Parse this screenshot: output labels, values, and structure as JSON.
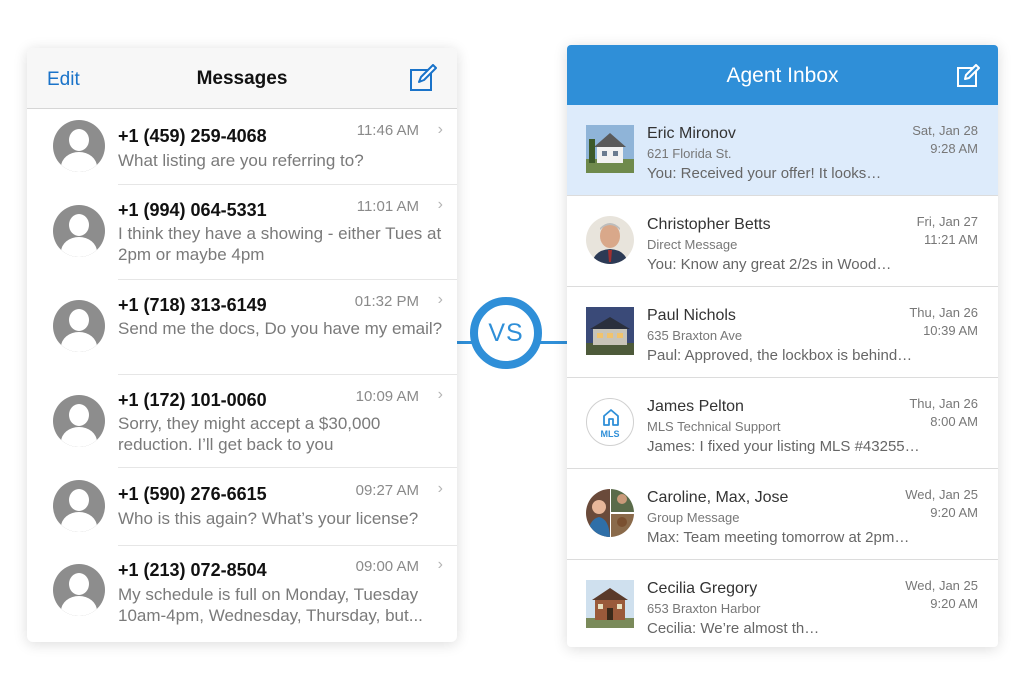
{
  "vs_label": "VS",
  "left": {
    "edit_label": "Edit",
    "title": "Messages",
    "compose_icon": "compose-icon",
    "messages": [
      {
        "phone": "+1 (459) 259-4068",
        "time": "11:46 AM",
        "preview": "What listing are you referring to?"
      },
      {
        "phone": "+1 (994) 064-5331",
        "time": "11:01 AM",
        "preview": "I think they have a showing - either Tues at 2pm or maybe 4pm"
      },
      {
        "phone": "+1 (718) 313-6149",
        "time": "01:32 PM",
        "preview": "Send me the docs, Do you have my email?"
      },
      {
        "phone": "+1 (172) 101-0060",
        "time": "10:09 AM",
        "preview": "Sorry, they might accept a $30,000 reduction. I’ll get back to you"
      },
      {
        "phone": "+1 (590) 276-6615",
        "time": "09:27 AM",
        "preview": "Who is this again? What’s your license?"
      },
      {
        "phone": "+1 (213) 072-8504",
        "time": "09:00 AM",
        "preview": "My schedule is full on Monday, Tuesday 10am-4pm, Wednesday, Thursday, but..."
      }
    ]
  },
  "right": {
    "title": "Agent Inbox",
    "accent": "#2f8fd8",
    "selected_bg": "#ddebfb",
    "conversations": [
      {
        "name": "Eric Mironov",
        "sub": "621 Florida St.",
        "preview": "You: Received your offer! It looks…",
        "date": "Sat, Jan 28",
        "time": "9:28 AM",
        "thumb": "house-photo-white"
      },
      {
        "name": "Christopher Betts",
        "sub": "Direct Message",
        "preview": "You: Know any great 2/2s in Wood…",
        "date": "Fri, Jan 27",
        "time": "11:21 AM",
        "thumb": "person-avatar"
      },
      {
        "name": "Paul Nichols",
        "sub": "635 Braxton Ave",
        "preview": "Paul: Approved, the lockbox is behind…",
        "date": "Thu, Jan 26",
        "time": "10:39 AM",
        "thumb": "house-photo-dusk"
      },
      {
        "name": "James Pelton",
        "sub": "MLS Technical Support",
        "preview": "James: I fixed your listing MLS #43255…",
        "date": "Thu, Jan 26",
        "time": "8:00 AM",
        "thumb": "mls-logo",
        "thumb_text": "MLS"
      },
      {
        "name": "Caroline, Max, Jose",
        "sub": "Group Message",
        "preview": "Max: Team meeting tomorrow at 2pm…",
        "date": "Wed, Jan 25",
        "time": "9:20 AM",
        "thumb": "group-avatar"
      },
      {
        "name": "Cecilia Gregory",
        "sub": "653 Braxton Harbor",
        "preview": "Cecilia: We’re almost th…",
        "date": "Wed, Jan 25",
        "time": "9:20 AM",
        "thumb": "house-photo-brick"
      }
    ]
  }
}
